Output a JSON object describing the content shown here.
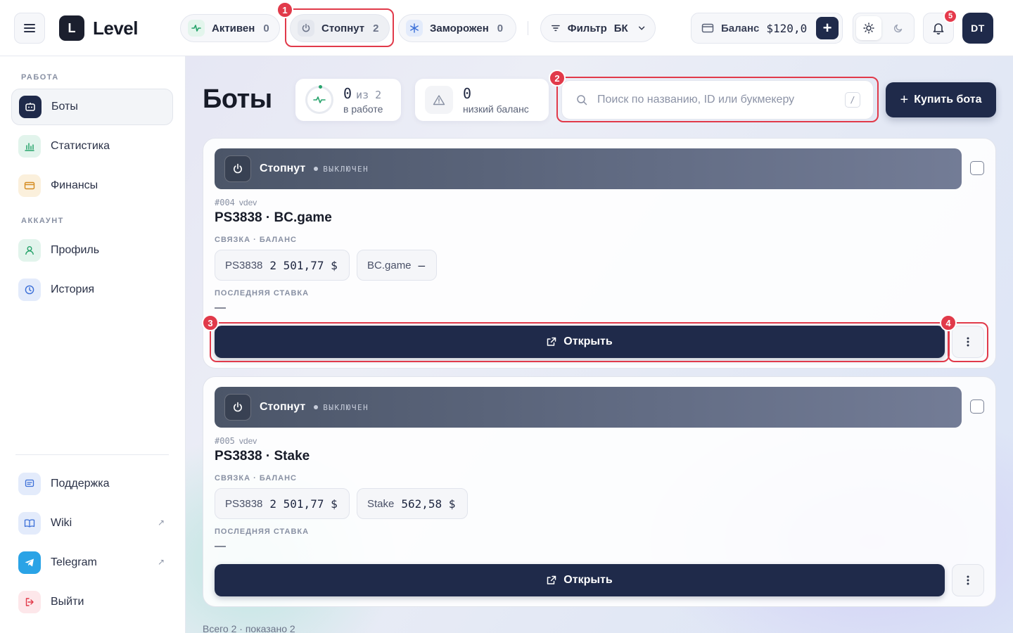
{
  "app": {
    "logo_mark": "L",
    "name": "Level"
  },
  "filters": {
    "active": {
      "label": "Активен",
      "count": "0"
    },
    "stopped": {
      "label": "Стопнут",
      "count": "2"
    },
    "frozen": {
      "label": "Заморожен",
      "count": "0"
    },
    "bk": {
      "label": "Фильтр",
      "value": "БК"
    }
  },
  "balance": {
    "label": "Баланс",
    "value": "$120,0"
  },
  "notifications": {
    "count": "5"
  },
  "user": {
    "initials": "DT"
  },
  "sidebar": {
    "work_label": "РАБОТА",
    "account_label": "АККАУНТ",
    "items": [
      {
        "label": "Боты"
      },
      {
        "label": "Статистика"
      },
      {
        "label": "Финансы"
      },
      {
        "label": "Профиль"
      },
      {
        "label": "История"
      }
    ],
    "bottom": [
      {
        "label": "Поддержка"
      },
      {
        "label": "Wiki"
      },
      {
        "label": "Telegram"
      },
      {
        "label": "Выйти"
      }
    ]
  },
  "page": {
    "title": "Боты",
    "stat_working": {
      "value": "0",
      "of": "из 2",
      "label": "в работе"
    },
    "stat_low": {
      "value": "0",
      "label": "низкий баланс"
    },
    "search": {
      "placeholder": "Поиск по названию, ID или букмекеру",
      "shortcut": "/"
    },
    "buy_label": "Купить бота",
    "footer": "Всего 2 · показано 2"
  },
  "bots": [
    {
      "status": "Стопнут",
      "state": "ВЫКЛЮЧЕН",
      "id": "#004",
      "owner": "vdev",
      "name": "PS3838 · BC.game",
      "link_label": "СВЯЗКА · БАЛАНС",
      "chips": [
        {
          "name": "PS3838",
          "value": "2 501,77 $"
        },
        {
          "name": "BC.game",
          "value": "—"
        }
      ],
      "last_bet_label": "ПОСЛЕДНЯЯ СТАВКА",
      "last_bet": "—",
      "open_label": "Открыть"
    },
    {
      "status": "Стопнут",
      "state": "ВЫКЛЮЧЕН",
      "id": "#005",
      "owner": "vdev",
      "name": "PS3838 · Stake",
      "link_label": "СВЯЗКА · БАЛАНС",
      "chips": [
        {
          "name": "PS3838",
          "value": "2 501,77 $"
        },
        {
          "name": "Stake",
          "value": "562,58 $"
        }
      ],
      "last_bet_label": "ПОСЛЕДНЯЯ СТАВКА",
      "last_bet": "—",
      "open_label": "Открыть"
    }
  ],
  "annotations": [
    "1",
    "2",
    "3",
    "4"
  ],
  "colors": {
    "primary": "#1f2a4a",
    "annotation": "#e13a4a",
    "active_green": "#27a36b"
  }
}
